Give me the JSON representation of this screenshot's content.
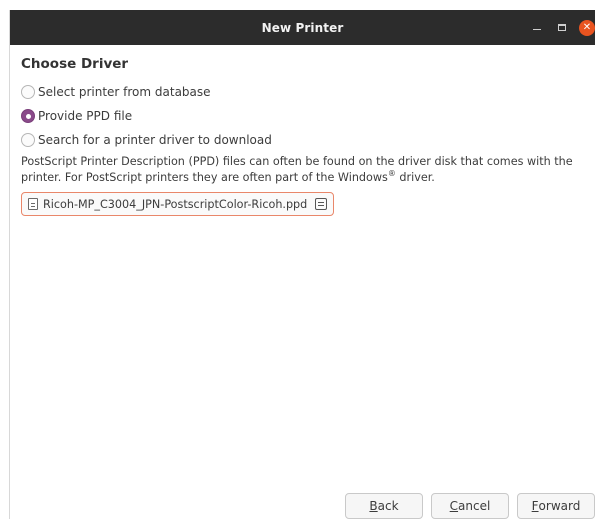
{
  "window": {
    "title": "New Printer"
  },
  "heading": "Choose Driver",
  "options": [
    {
      "label": "Select printer from database",
      "checked": false
    },
    {
      "label": "Provide PPD file",
      "checked": true
    },
    {
      "label": "Search for a printer driver to download",
      "checked": false
    }
  ],
  "description": {
    "text": "PostScript Printer Description (PPD) files can often be found on the driver disk that comes with the printer. For PostScript printers they are often part of the Windows",
    "registered": "®",
    "suffix": " driver."
  },
  "file_chooser": {
    "filename": "Ricoh-MP_C3004_JPN-PostscriptColor-Ricoh.ppd"
  },
  "buttons": {
    "back": {
      "mnemonic": "B",
      "rest": "ack"
    },
    "cancel": {
      "mnemonic": "C",
      "rest": "ancel"
    },
    "forward": {
      "mnemonic": "F",
      "rest": "orward"
    }
  },
  "colors": {
    "accent": "#e95420",
    "radio_checked": "#8a4a8a",
    "titlebar": "#2c2c2c",
    "chooser_border": "#e9876a"
  }
}
